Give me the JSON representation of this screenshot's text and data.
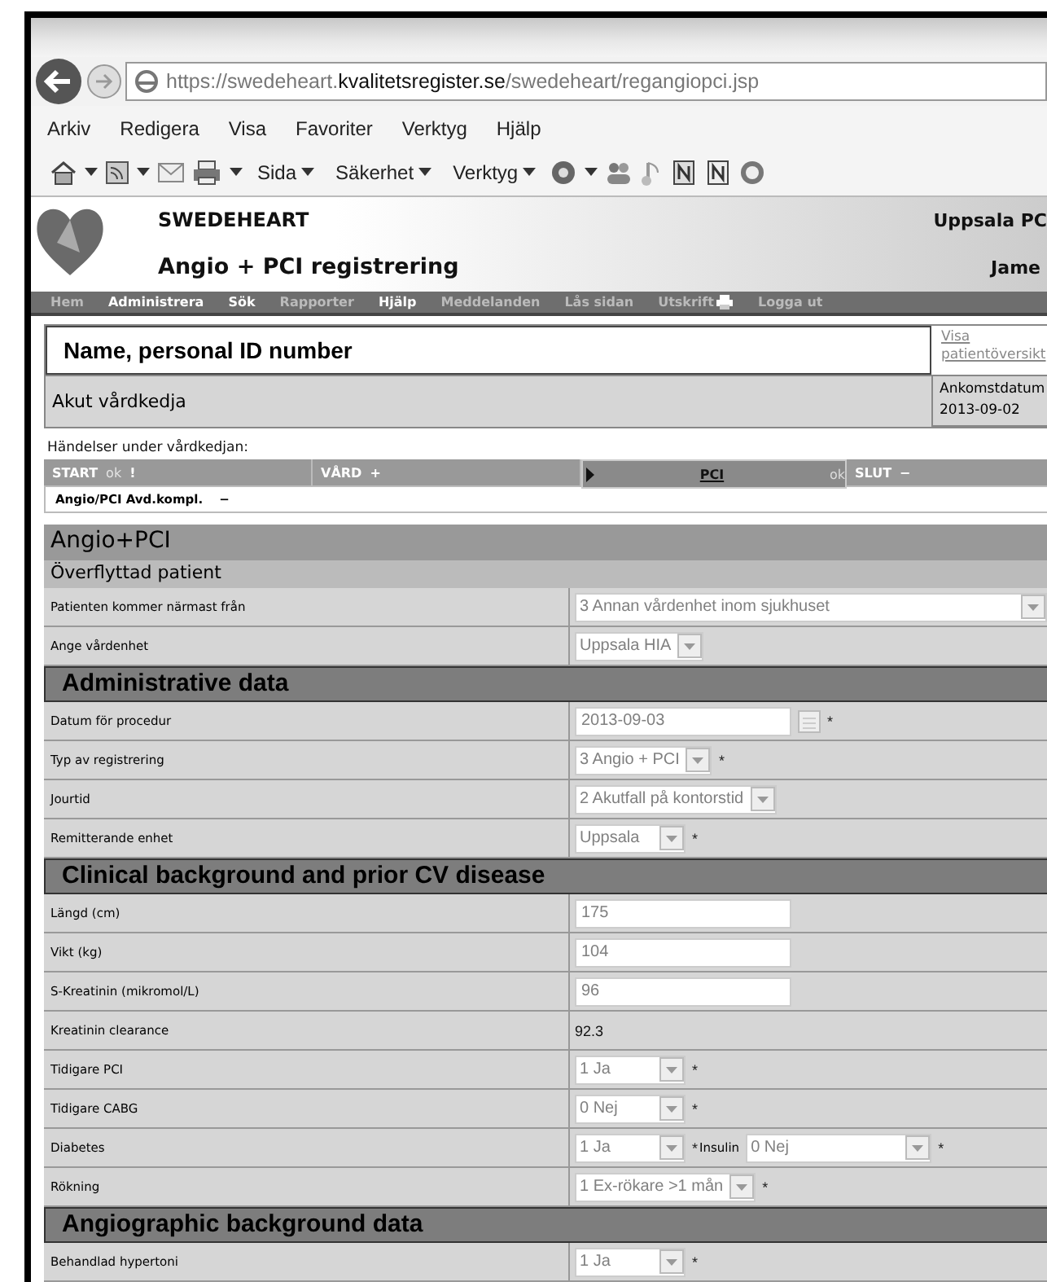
{
  "browser": {
    "url_scheme": "https://",
    "url_host": "swedeheart.",
    "url_domain": "kvalitetsregister.se",
    "url_path": "/swedeheart/regangiopci.jsp",
    "menu": [
      "Arkiv",
      "Redigera",
      "Visa",
      "Favoriter",
      "Verktyg",
      "Hjälp"
    ],
    "toolbar": [
      "Sida",
      "Säkerhet",
      "Verktyg"
    ]
  },
  "header": {
    "brand": "SWEDEHEART",
    "subtitle": "Angio + PCI registrering",
    "unit": "Uppsala PC",
    "user": "Jame"
  },
  "nav": [
    {
      "label": "Hem",
      "highlighted": false
    },
    {
      "label": "Administrera",
      "highlighted": true
    },
    {
      "label": "Sök",
      "highlighted": true
    },
    {
      "label": "Rapporter",
      "highlighted": false
    },
    {
      "label": "Hjälp",
      "highlighted": true
    },
    {
      "label": "Meddelanden",
      "highlighted": false
    },
    {
      "label": "Lås sidan",
      "highlighted": false
    },
    {
      "label": "Utskrift",
      "highlighted": false,
      "icon": true
    },
    {
      "label": "Logga ut",
      "highlighted": false
    }
  ],
  "patient": {
    "name": "Name, personal ID number",
    "link": "Visa patientöversikt",
    "chain": "Akut vårdkedja",
    "arrival_label": "Ankomstdatum",
    "arrival_date": "2013-09-02"
  },
  "events": {
    "label": "Händelser under vårdkedjan:",
    "tabs": [
      {
        "label": "START",
        "status": "ok",
        "symbol": "!",
        "selected": false
      },
      {
        "label": "VÅRD",
        "symbol": "+",
        "selected": false
      },
      {
        "label": "PCI",
        "status": "ok",
        "selected": true
      },
      {
        "label": "SLUT",
        "symbol": "−",
        "selected": false
      }
    ],
    "sub_label": "Angio/PCI Avd.kompl.",
    "sub_symbol": "−"
  },
  "form": {
    "title": "Angio+PCI",
    "sections": [
      {
        "title": "Överflyttad patient",
        "kind": "light",
        "rows": [
          {
            "label": "Patienten kommer närmast från",
            "kind": "select",
            "value": "3 Annan vårdenhet inom sjukhuset"
          },
          {
            "label": "Ange vårdenhet",
            "kind": "select",
            "value": "Uppsala HIA"
          }
        ]
      },
      {
        "title": "Administrative data",
        "kind": "dark",
        "rows": [
          {
            "label": "Datum för procedur",
            "kind": "date",
            "value": "2013-09-03",
            "mark": "*"
          },
          {
            "label": "Typ av registrering",
            "kind": "select",
            "value": "3 Angio + PCI",
            "mark": "*"
          },
          {
            "label": "Jourtid",
            "kind": "select",
            "value": "2 Akutfall på kontorstid"
          },
          {
            "label": "Remitterande enhet",
            "kind": "select",
            "value": "Uppsala",
            "mark": "*"
          }
        ]
      },
      {
        "title": "Clinical background and prior CV disease",
        "kind": "dark",
        "rows": [
          {
            "label": "Längd (cm)",
            "kind": "input",
            "value": "175"
          },
          {
            "label": "Vikt (kg)",
            "kind": "input",
            "value": "104"
          },
          {
            "label": "S-Kreatinin (mikromol/L)",
            "kind": "input",
            "value": "96"
          },
          {
            "label": "Kreatinin clearance",
            "kind": "text",
            "value": "92.3"
          },
          {
            "label": "Tidigare PCI",
            "kind": "select",
            "value": "1 Ja",
            "mark": "*"
          },
          {
            "label": "Tidigare CABG",
            "kind": "select",
            "value": "0 Nej",
            "mark": "*"
          },
          {
            "label": "Diabetes",
            "kind": "select",
            "value": "1 Ja",
            "mark": "*",
            "extra_label": "Insulin",
            "extra_value": "0 Nej",
            "extra_mark": "*"
          },
          {
            "label": "Rökning",
            "kind": "select",
            "value": "1 Ex-rökare >1 mån",
            "mark": "*"
          }
        ]
      },
      {
        "title": "Angiographic background data",
        "kind": "dark",
        "rows": [
          {
            "label": "Behandlad hypertoni",
            "kind": "select",
            "value": "1 Ja",
            "mark": "*"
          }
        ]
      }
    ]
  }
}
